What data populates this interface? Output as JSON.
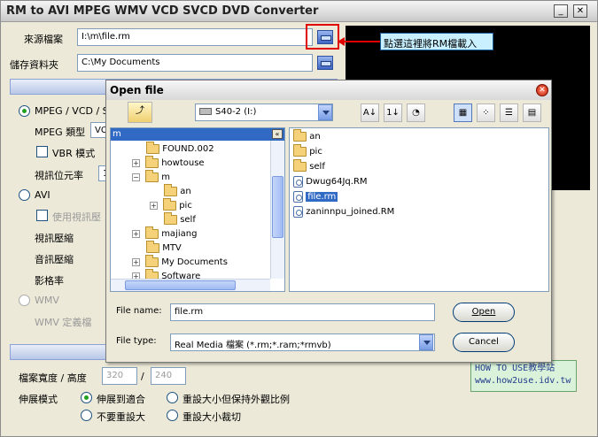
{
  "app": {
    "title": "RM to AVI MPEG WMV VCD SVCD DVD Converter",
    "window_controls": {
      "minimize": "_",
      "close": "✕"
    }
  },
  "source": {
    "label": "來源檔案",
    "value": "I:\\m\\file.rm"
  },
  "output": {
    "label": "儲存資料夾",
    "value": "C:\\My Documents"
  },
  "callout": {
    "text": "點選這裡將RM檔載入",
    "accent": "#e00000"
  },
  "formats": {
    "mpeg_label": "MPEG / VCD / SV",
    "mpeg_type_label": "MPEG 類型",
    "mpeg_type_value": "VC",
    "vbr_label": "VBR 模式",
    "bitrate_label": "視訊位元率",
    "bitrate_value": "1",
    "avi_label": "AVI",
    "use_video_label": "使用視訊壓",
    "video_comp_label": "視訊壓縮",
    "audio_comp_label": "音訊壓縮",
    "framerate_label": "影格率",
    "wmv_label": "WMV",
    "wmv_def_label": "WMV 定義檔"
  },
  "size": {
    "wh_label": "檔案寬度 / 高度",
    "width": "320",
    "sep": "/",
    "height": "240",
    "stretch_label": "伸展模式",
    "options": [
      "伸展到適合",
      "重設大小但保持外觀比例",
      "不要重設大",
      "重設大小裁切"
    ]
  },
  "dialog": {
    "title": "Open file",
    "drive": "S40-2 (I:)",
    "path_label": "m",
    "tree": [
      {
        "name": "FOUND.002",
        "indent": 0,
        "expander": ""
      },
      {
        "name": "howtouse",
        "indent": 0,
        "expander": "+"
      },
      {
        "name": "m",
        "indent": 0,
        "expander": "-"
      },
      {
        "name": "an",
        "indent": 1,
        "expander": ""
      },
      {
        "name": "pic",
        "indent": 1,
        "expander": "+"
      },
      {
        "name": "self",
        "indent": 1,
        "expander": ""
      },
      {
        "name": "majiang",
        "indent": 0,
        "expander": "+"
      },
      {
        "name": "MTV",
        "indent": 0,
        "expander": ""
      },
      {
        "name": "My Documents",
        "indent": 0,
        "expander": "+"
      },
      {
        "name": "Software",
        "indent": 0,
        "expander": "+"
      }
    ],
    "files": [
      {
        "name": "an",
        "kind": "folder"
      },
      {
        "name": "pic",
        "kind": "folder"
      },
      {
        "name": "self",
        "kind": "folder"
      },
      {
        "name": "Dwug64Jq.RM",
        "kind": "file"
      },
      {
        "name": "file.rm",
        "kind": "file",
        "selected": true
      },
      {
        "name": "zaninnpu_joined.RM",
        "kind": "file"
      }
    ],
    "filename_label": "File name:",
    "filename_value": "file.rm",
    "filetype_label": "File type:",
    "filetype_value": "Real Media 檔案 (*.rm;*.ram;*rmvb)",
    "open_label": "Open",
    "cancel_label": "Cancel",
    "toolbar_icons": [
      "up-folder-icon",
      "sort-az-icon",
      "sort-09-icon",
      "sort-date-icon",
      "large-icons-icon",
      "small-icons-icon",
      "list-icon",
      "details-icon"
    ]
  },
  "watermark": {
    "line1": "HOW TO USE教學站",
    "line2": "www.how2use.idv.tw"
  },
  "colors": {
    "title_bg": "#dcdcdc",
    "selection": "#316ac5",
    "preview": "#000000",
    "callout_bg": "#c8f0ff"
  }
}
